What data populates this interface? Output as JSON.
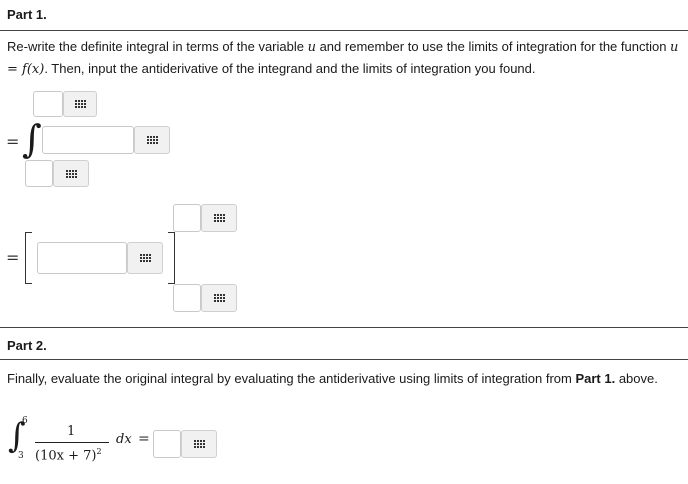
{
  "part1": {
    "title": "Part 1.",
    "instruction": {
      "text_before": "Re-write the definite integral in terms of the variable ",
      "var_u": "u",
      "text_mid": " and remember to use the limits of integration for the function ",
      "func": "u = f(x)",
      "text_after": ". Then, input the antiderivative of the integrand and the limits of integration you found."
    },
    "integral_row": {
      "equals": "=",
      "integral_sign": "∫"
    },
    "bracket_row": {
      "equals": "=",
      "left_bracket": "[",
      "right_bracket": "]"
    }
  },
  "part2": {
    "title": "Part 2.",
    "instruction": {
      "text_before": "Finally, evaluate the original integral by evaluating the antiderivative using limits of integration from ",
      "bold_ref": "Part 1.",
      "text_after": " above."
    },
    "integral": {
      "upper_limit": "6",
      "lower_limit": "3",
      "numerator": "1",
      "denominator": "(10x + 7)",
      "exponent": "2",
      "differential": "dx",
      "equals": "="
    }
  },
  "inputs": {
    "upper_limit_1": "",
    "integrand": "",
    "lower_limit_1": "",
    "upper_limit_2": "",
    "antiderivative": "",
    "lower_limit_2": "",
    "final_answer": ""
  },
  "icons": {
    "keypad": "keypad-grid-icon"
  },
  "colors": {
    "rule": "#444444",
    "input_border": "#c9c9c9",
    "keypad_bg": "#f1f1f1"
  }
}
